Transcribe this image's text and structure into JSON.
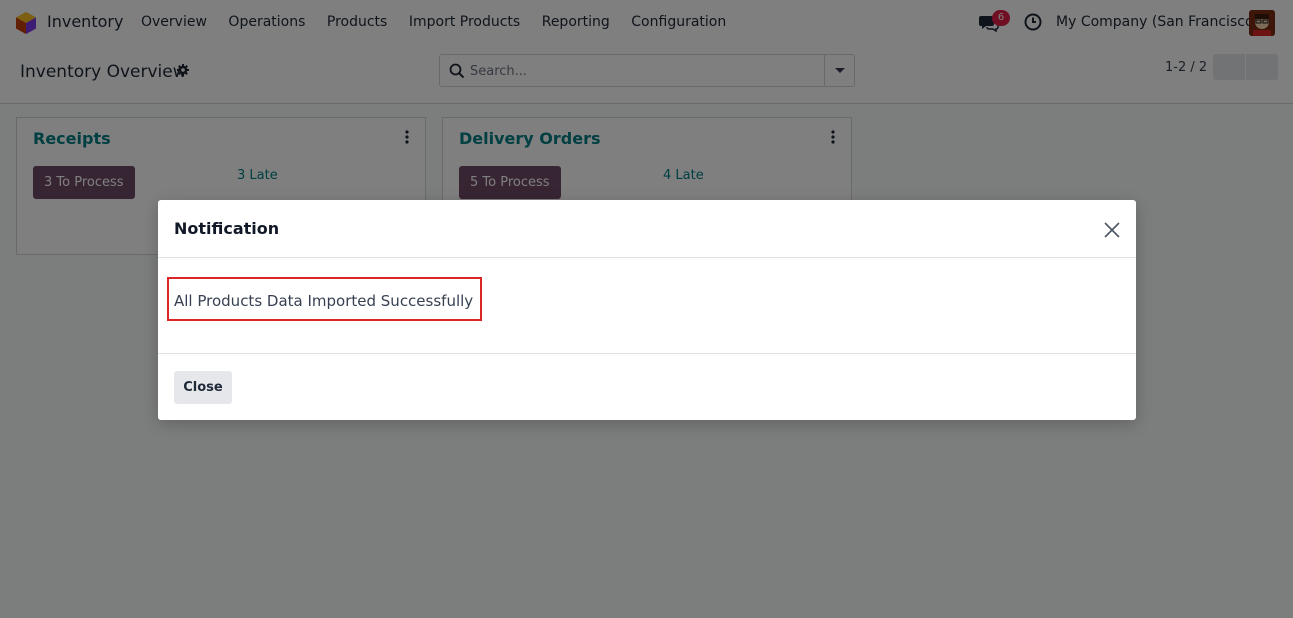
{
  "navbar": {
    "app_name": "Inventory",
    "menu": [
      "Overview",
      "Operations",
      "Products",
      "Import Products",
      "Reporting",
      "Configuration"
    ],
    "chat_count": "6",
    "company": "My Company (San Francisco)"
  },
  "control": {
    "title": "Inventory Overview",
    "search_placeholder": "Search...",
    "pager": "1-2 / 2"
  },
  "cards": [
    {
      "title": "Receipts",
      "process_label": "3 To Process",
      "late_label": "3 Late"
    },
    {
      "title": "Delivery Orders",
      "process_label": "5 To Process",
      "late_label": "4 Late"
    }
  ],
  "modal": {
    "title": "Notification",
    "message": "All Products Data Imported Successfully",
    "close_label": "Close"
  },
  "colors": {
    "brand": "#714b67",
    "accent": "#017e84",
    "badge": "#e11d48",
    "highlight": "#dc2626"
  }
}
